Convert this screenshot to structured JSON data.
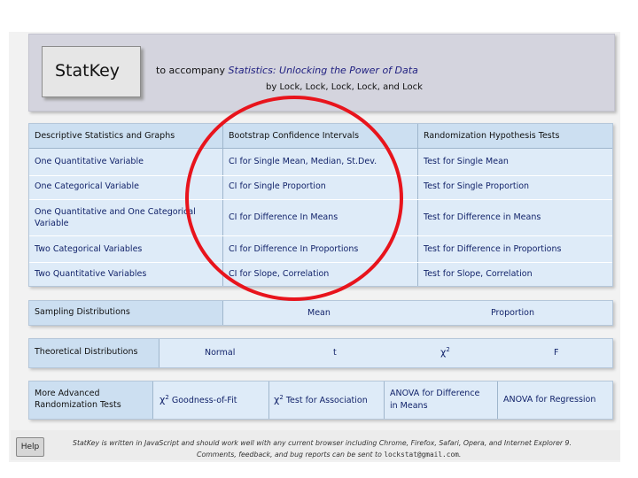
{
  "header": {
    "logo": "StatKey",
    "accompany_prefix": "to accompany ",
    "book_title": "Statistics: Unlocking the Power of Data",
    "authors": "by Lock, Lock, Lock, Lock, and Lock"
  },
  "main_table": {
    "headers": [
      "Descriptive Statistics and Graphs",
      "Bootstrap Confidence Intervals",
      "Randomization Hypothesis Tests"
    ],
    "rows": [
      [
        "One Quantitative Variable",
        "CI for Single Mean, Median, St.Dev.",
        "Test for Single Mean"
      ],
      [
        "One Categorical Variable",
        "CI for Single Proportion",
        "Test for Single Proportion"
      ],
      [
        "One Quantitative and One Categorical Variable",
        "CI for Difference In Means",
        "Test for Difference in Means"
      ],
      [
        "Two Categorical Variables",
        "CI for Difference In Proportions",
        "Test for Difference in Proportions"
      ],
      [
        "Two Quantitative Variables",
        "CI for Slope, Correlation",
        "Test for Slope, Correlation"
      ]
    ],
    "row3_col1_line1": "One Quantitative and One Categorical",
    "row3_col1_line2": "Variable"
  },
  "sampling": {
    "label": "Sampling Distributions",
    "mean": "Mean",
    "proportion": "Proportion"
  },
  "theoretical": {
    "label": "Theoretical Distributions",
    "normal": "Normal",
    "t": "t",
    "chi": "χ",
    "chi_sup": "2",
    "f": "F"
  },
  "advanced": {
    "label_line1": "More Advanced",
    "label_line2": "Randomization Tests",
    "chi": "χ",
    "chi_sup": "2",
    "gof": " Goodness-of-Fit",
    "assoc": " Test for Association",
    "anova_diff_line1": "ANOVA for Difference",
    "anova_diff_line2": "in Means",
    "anova_reg": "ANOVA for Regression"
  },
  "footer": {
    "help": "Help",
    "line1": "StatKey is written in JavaScript and should work well with any current browser including Chrome, Firefox, Safari, Opera, and Internet Explorer 9.",
    "line2_prefix": "Comments, feedback, and bug reports can be sent to ",
    "email": "lockstat@gmail.com",
    "line2_suffix": "."
  },
  "colors": {
    "accent_circle": "#e8141c",
    "panel": "#deebf8",
    "link": "#12236a"
  }
}
